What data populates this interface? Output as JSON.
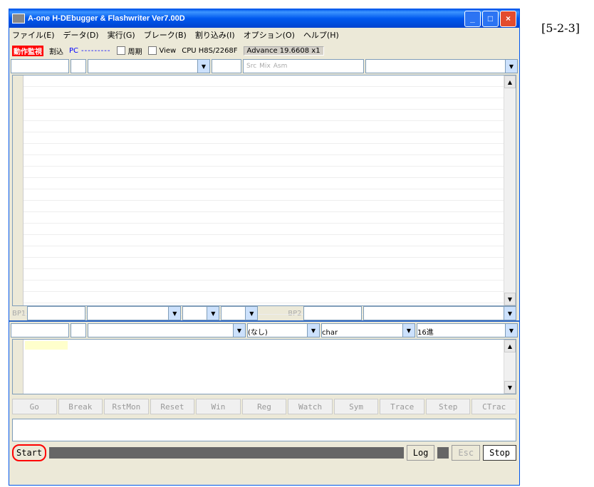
{
  "window": {
    "title": "A-one H-DEbugger & Flashwriter Ver7.00D"
  },
  "annotation": "[5-2-3]",
  "menu": [
    "ファイル(E)",
    "データ(D)",
    "実行(G)",
    "ブレーク(B)",
    "割り込み(I)",
    "オプション(O)",
    "ヘルプ(H)"
  ],
  "status": {
    "red_label": "動作監視",
    "interrupt": "割込",
    "pc_label": "PC",
    "pc_value": "---------",
    "cycle": "周期",
    "view": "View",
    "cpu": "CPU H8S/2268F",
    "advance": "Advance 19.6608 x1"
  },
  "radio_options": [
    "Src",
    "Mix",
    "Asm"
  ],
  "bp_labels": [
    "BP1",
    "BP2"
  ],
  "watch_settings": {
    "mode": "(なし)",
    "type": "char",
    "base": "16進"
  },
  "command_buttons": [
    "Go",
    "Break",
    "RstMon",
    "Reset",
    "Win",
    "Reg",
    "Watch",
    "Sym",
    "Trace",
    "Step",
    "CTrac"
  ],
  "bottom_bar": {
    "start": "Start",
    "log": "Log",
    "esc": "Esc",
    "stop": "Stop"
  }
}
